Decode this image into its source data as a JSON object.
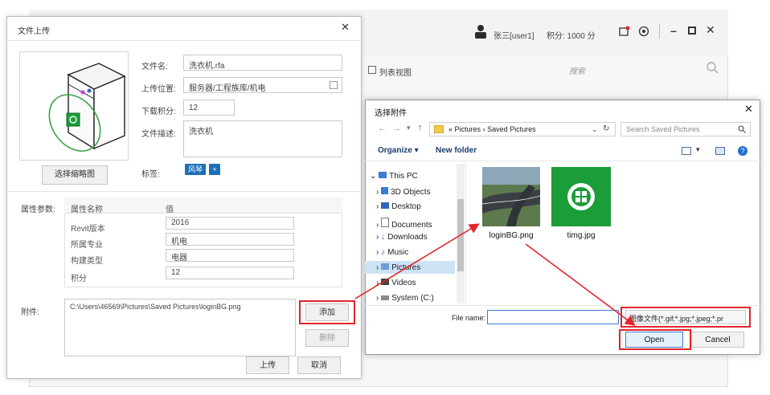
{
  "main_app": {
    "user_label": "张三[user1]",
    "points_label": "积分: 1000 分",
    "list_view_label": "列表视图",
    "search_placeholder": "搜索"
  },
  "upload_dialog": {
    "title": "文件上传",
    "select_thumbnail_button": "选择缩略图",
    "fields": {
      "filename_label": "文件名:",
      "filename_value": "洗衣机.rfa",
      "location_label": "上传位置:",
      "location_value": "服务器/工程族库/机电",
      "points_label": "下载积分:",
      "points_value": "12",
      "description_label": "文件描述:",
      "description_value": "洗衣机",
      "tags_label": "标签:",
      "tag_text": "风琴",
      "tag_add": "+"
    },
    "properties": {
      "section_label": "属性参数:",
      "header_name": "属性名称",
      "header_value": "值",
      "rows": [
        {
          "name": "Revit版本",
          "value": "2016"
        },
        {
          "name": "所属专业",
          "value": "机电"
        },
        {
          "name": "构建类型",
          "value": "电器"
        },
        {
          "name": "积分",
          "value": "12"
        }
      ]
    },
    "attachments": {
      "label": "附件:",
      "path": "C:\\Users\\46569\\Pictures\\Saved Pictures\\loginBG.png",
      "add_button": "添加",
      "delete_button": "删除"
    },
    "upload_button": "上传",
    "cancel_button": "取消"
  },
  "file_picker": {
    "title": "选择附件",
    "breadcrumb": [
      "«",
      "Pictures",
      "›",
      "Saved Pictures"
    ],
    "search_placeholder": "Search Saved Pictures",
    "organize_label": "Organize ▾",
    "new_folder_label": "New folder",
    "tree": [
      {
        "label": "This PC",
        "icon": "pc-icon"
      },
      {
        "label": "3D Objects",
        "icon": "cube-icon"
      },
      {
        "label": "Desktop",
        "icon": "desktop-icon"
      },
      {
        "label": "Documents",
        "icon": "document-icon"
      },
      {
        "label": "Downloads",
        "icon": "download-icon"
      },
      {
        "label": "Music",
        "icon": "music-icon"
      },
      {
        "label": "Pictures",
        "icon": "pictures-icon"
      },
      {
        "label": "Videos",
        "icon": "video-icon"
      },
      {
        "label": "System (C:)",
        "icon": "drive-icon"
      }
    ],
    "files": [
      {
        "name": "loginBG.png"
      },
      {
        "name": "timg.jpg"
      }
    ],
    "filename_label": "File name:",
    "filetype_value": "图像文件(*.gif;*.jpg;*.jpeg;*.pr",
    "open_button": "Open",
    "cancel_button": "Cancel"
  },
  "colors": {
    "highlight_red": "#e0262b",
    "tag_blue": "#1f6fb8",
    "timg_green": "#1b9d3a"
  }
}
